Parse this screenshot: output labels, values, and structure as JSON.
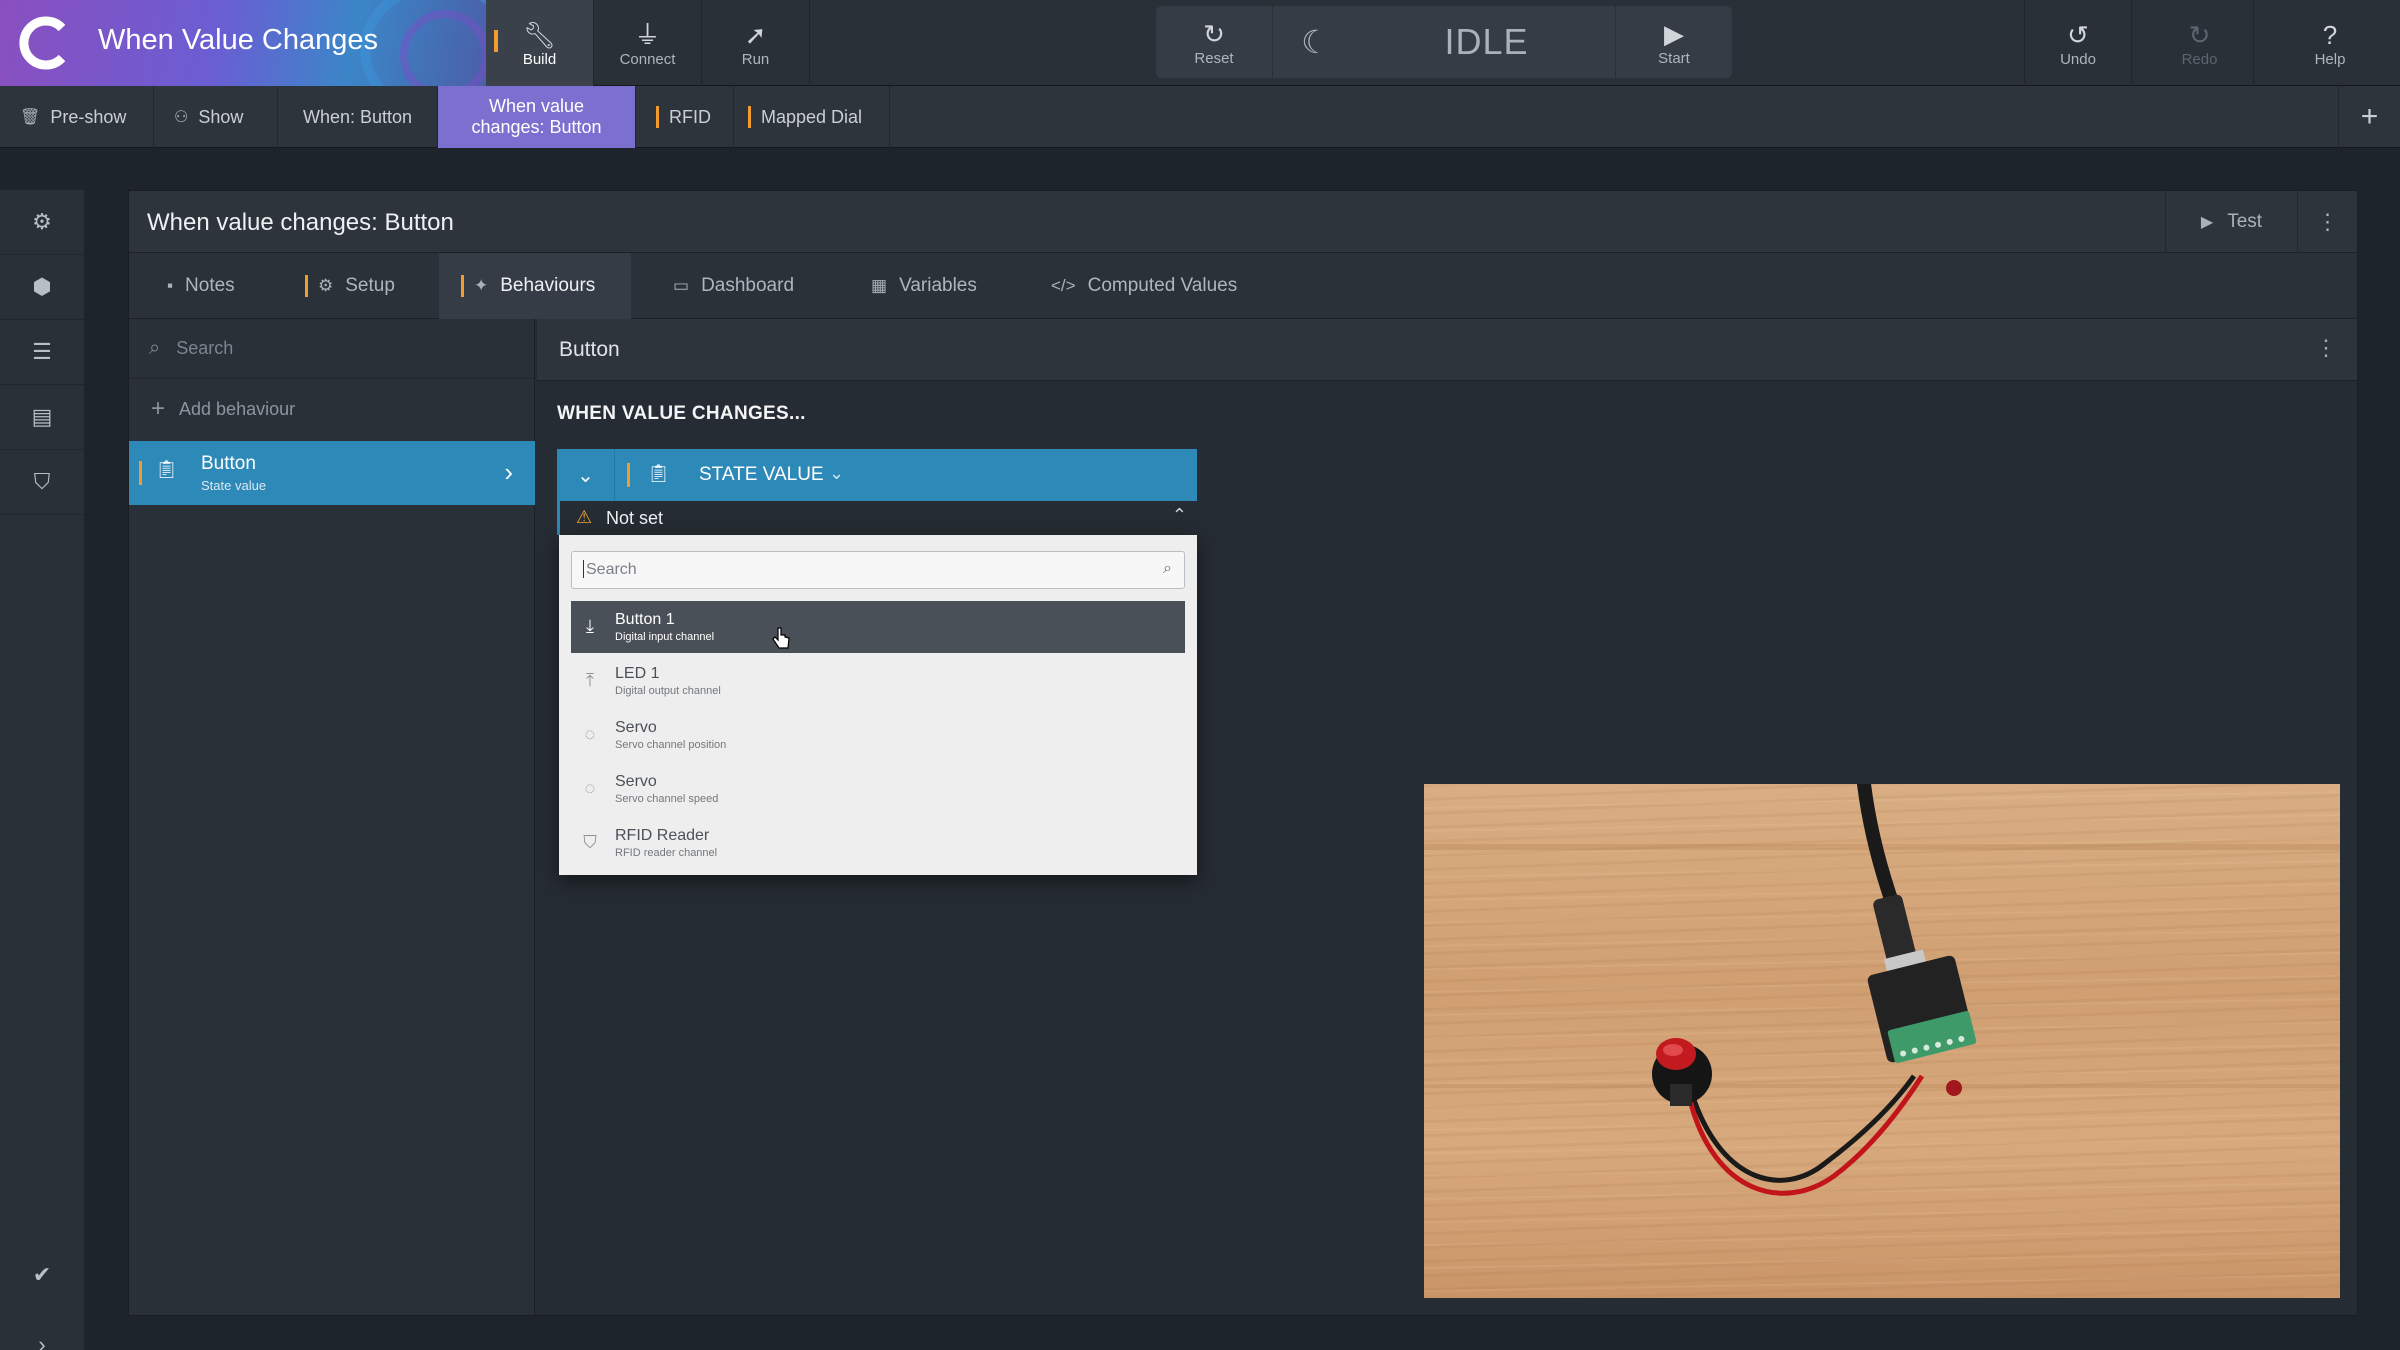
{
  "app": {
    "title": "When Value Changes"
  },
  "toolbar": {
    "build": "Build",
    "connect": "Connect",
    "run": "Run",
    "reset": "Reset",
    "status": "IDLE",
    "start": "Start",
    "undo": "Undo",
    "redo": "Redo",
    "help": "Help"
  },
  "scene_tabs": [
    {
      "label": "Pre-show",
      "icon": "trash-icon"
    },
    {
      "label": "Show",
      "icon": "group-icon"
    },
    {
      "label": "When: Button"
    },
    {
      "label_line1": "When value",
      "label_line2": "changes: Button"
    },
    {
      "label": "RFID"
    },
    {
      "label": "Mapped Dial"
    }
  ],
  "panel": {
    "title": "When value changes: Button",
    "test": "Test",
    "tabs": {
      "notes": "Notes",
      "setup": "Setup",
      "behaviours": "Behaviours",
      "dashboard": "Dashboard",
      "variables": "Variables",
      "computed": "Computed Values"
    }
  },
  "sidebar": {
    "search_placeholder": "Search",
    "add_behaviour": "Add behaviour",
    "items": [
      {
        "name": "Button",
        "subtitle": "State value"
      }
    ]
  },
  "content": {
    "header": "Button",
    "section_title": "WHEN VALUE CHANGES...",
    "trigger_label": "STATE VALUE",
    "not_set": "Not set"
  },
  "dropdown": {
    "placeholder": "Search",
    "options": [
      {
        "name": "Button 1",
        "subtitle": "Digital input channel",
        "icon": "download-icon",
        "selected": true
      },
      {
        "name": "LED 1",
        "subtitle": "Digital output channel",
        "icon": "upload-icon",
        "selected": false
      },
      {
        "name": "Servo",
        "subtitle": "Servo channel position",
        "icon": "circle-icon",
        "selected": false
      },
      {
        "name": "Servo",
        "subtitle": "Servo channel speed",
        "icon": "circle-icon",
        "selected": false
      },
      {
        "name": "RFID Reader",
        "subtitle": "RFID reader channel",
        "icon": "tag-icon",
        "selected": false
      }
    ]
  },
  "colors": {
    "accent_blue": "#2d89b8",
    "accent_orange": "#f29b2f",
    "active_scene_tab": "#7b6fd0"
  }
}
